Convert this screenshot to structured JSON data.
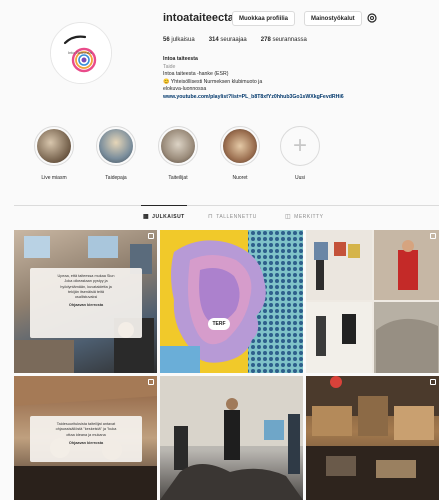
{
  "profile": {
    "username": "intoataiteecta",
    "edit_label": "Muokkaa profiilia",
    "promo_label": "Mainostyökalut",
    "stats": {
      "posts": "56",
      "posts_label": "julkaisua",
      "followers": "314",
      "followers_label": "seuraajaa",
      "following": "278",
      "following_label": "seurannassa"
    },
    "bio": {
      "name": "Intoa taiteesta",
      "category": "Taide",
      "line1": "Intoa taiteesta -hanke (ESR)",
      "line2": "😊 Yhteisöllisesti Nurmeksen klubimuoto ja",
      "line3": "elokuva-luonnossa",
      "link": "www.youtube.com/playlist?list=PL_b8T8xfYz0hhub3Go1sWXkgFevdRHi6"
    }
  },
  "highlights": [
    {
      "label": "Live miasm",
      "color": "#7a6b5a"
    },
    {
      "label": "Taidepaja",
      "color": "#6a7d8a"
    },
    {
      "label": "Taiteilijat",
      "color": "#9a8a7a"
    },
    {
      "label": "Nuoret",
      "color": "#8a6a5a"
    },
    {
      "label": "Uusi",
      "color": "#fafafa"
    }
  ],
  "tabs": [
    {
      "label": "JULKAISUT",
      "icon": "grid-icon",
      "active": true
    },
    {
      "label": "TALLENNETTU",
      "icon": "bookmark-icon",
      "active": false
    },
    {
      "label": "MERKITTY",
      "icon": "tag-icon",
      "active": false
    }
  ],
  "posts": [
    {
      "overlay": {
        "line1": "Upeaa, että taiteessa mukaa Siun",
        "line2": "Joka oikeastaan pystyy ja",
        "line3": "hyödyntämään, kuvataidetta ja",
        "line4": "tekijän itsenäisiä teitä",
        "line5": "osallistuvaksi",
        "caption": "Ohjaavan kierrosta"
      }
    },
    {
      "badge": "TERF"
    },
    {},
    {
      "overlay": {
        "line1": "Taidesuurituksista taiteilijat antavat",
        "line2": "ohjaussisällöstä \"keskeistä\" ja \"kuka",
        "line3": "ottaa ideana ja mukana",
        "caption": "Ohjaavan kierrosta"
      }
    },
    {},
    {}
  ]
}
